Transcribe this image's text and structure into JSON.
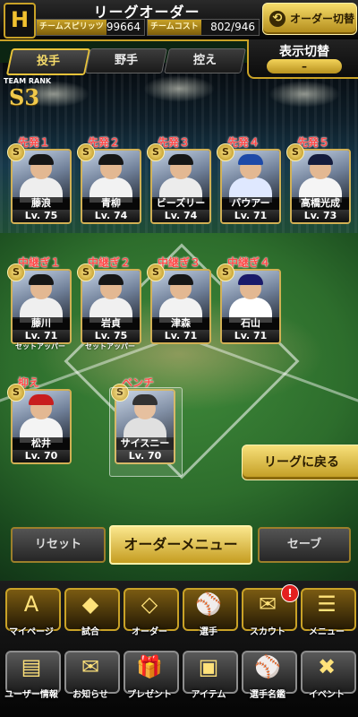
{
  "header": {
    "title": "リーグオーダー",
    "team_spirit_label": "チームスピリッツ",
    "team_spirit_value": "99664",
    "team_cost_label": "チームコスト",
    "team_cost_value": "802/946",
    "order_switch_label": "オーダー切替",
    "logo_glyph": "H"
  },
  "display_toggle": {
    "title": "表示切替",
    "value": "–"
  },
  "tabs": [
    {
      "label": "投手",
      "active": true
    },
    {
      "label": "野手",
      "active": false
    },
    {
      "label": "控え",
      "active": false
    }
  ],
  "team_rank": {
    "label": "TEAM RANK",
    "value": "S3"
  },
  "starters": [
    {
      "position": "先発１",
      "name": "藤浪",
      "level": "Lv. 75",
      "rank": "S",
      "cap": "#161616",
      "uniform": "#eeeeee"
    },
    {
      "position": "先発２",
      "name": "青柳",
      "level": "Lv. 74",
      "rank": "S",
      "cap": "#161616",
      "uniform": "#f2f2f2"
    },
    {
      "position": "先発３",
      "name": "ビーズリー",
      "level": "Lv. 74",
      "rank": "S",
      "cap": "#161616",
      "uniform": "#ececec"
    },
    {
      "position": "先発４",
      "name": "バウアー",
      "level": "Lv. 71",
      "rank": "S",
      "cap": "#1e4aa8",
      "uniform": "#dfe8ff"
    },
    {
      "position": "先発５",
      "name": "高橋光成",
      "level": "Lv. 73",
      "rank": "S",
      "cap": "#141c3c",
      "uniform": "#f5f5f5"
    }
  ],
  "relievers": [
    {
      "position": "中継ぎ１",
      "name": "藤川",
      "level": "Lv. 71",
      "rank": "S",
      "note": "セットアッパー",
      "cap": "#161616",
      "uniform": "#efefef"
    },
    {
      "position": "中継ぎ２",
      "name": "岩貞",
      "level": "Lv. 75",
      "rank": "S",
      "note": "セットアッパー",
      "cap": "#161616",
      "uniform": "#f0f0f0"
    },
    {
      "position": "中継ぎ３",
      "name": "津森",
      "level": "Lv. 71",
      "rank": "S",
      "note": "",
      "cap": "#161616",
      "uniform": "#f2f2f2"
    },
    {
      "position": "中継ぎ４",
      "name": "石山",
      "level": "Lv. 71",
      "rank": "S",
      "note": "",
      "cap": "#1a1a6a",
      "uniform": "#ffffff"
    }
  ],
  "closer": {
    "position": "抑え",
    "name": "松井",
    "level": "Lv. 70",
    "rank": "S",
    "cap": "#c81e1e",
    "uniform": "#f4f4f4"
  },
  "bench": {
    "position": "ベンチ",
    "name": "サイスニード",
    "level": "Lv. 70",
    "rank": "S",
    "cap": "#161616",
    "uniform": "#dcdcdc"
  },
  "league_back_label": "リーグに戻る",
  "actions": {
    "reset": "リセット",
    "order_menu": "オーダーメニュー",
    "save": "セーブ"
  },
  "nav_row1": [
    {
      "label": "マイページ",
      "glyph": "A",
      "icon": "mypage-icon"
    },
    {
      "label": "試合",
      "glyph": "◆",
      "icon": "stadium-icon"
    },
    {
      "label": "オーダー",
      "glyph": "◇",
      "icon": "order-icon"
    },
    {
      "label": "選手",
      "glyph": "⚾",
      "icon": "player-icon"
    },
    {
      "label": "スカウト",
      "glyph": "✉",
      "icon": "scout-icon",
      "badge": "!"
    },
    {
      "label": "メニュー",
      "glyph": "☰",
      "icon": "menu-icon"
    }
  ],
  "nav_row2": [
    {
      "label": "ユーザー情報",
      "glyph": "▤",
      "icon": "user-info-icon"
    },
    {
      "label": "お知らせ",
      "glyph": "✉",
      "icon": "news-icon"
    },
    {
      "label": "プレゼント",
      "glyph": "🎁",
      "icon": "present-icon"
    },
    {
      "label": "アイテム",
      "glyph": "▣",
      "icon": "item-icon"
    },
    {
      "label": "選手名鑑",
      "glyph": "⚾",
      "icon": "player-directory-icon"
    },
    {
      "label": "イベント",
      "glyph": "✖",
      "icon": "event-icon"
    }
  ]
}
